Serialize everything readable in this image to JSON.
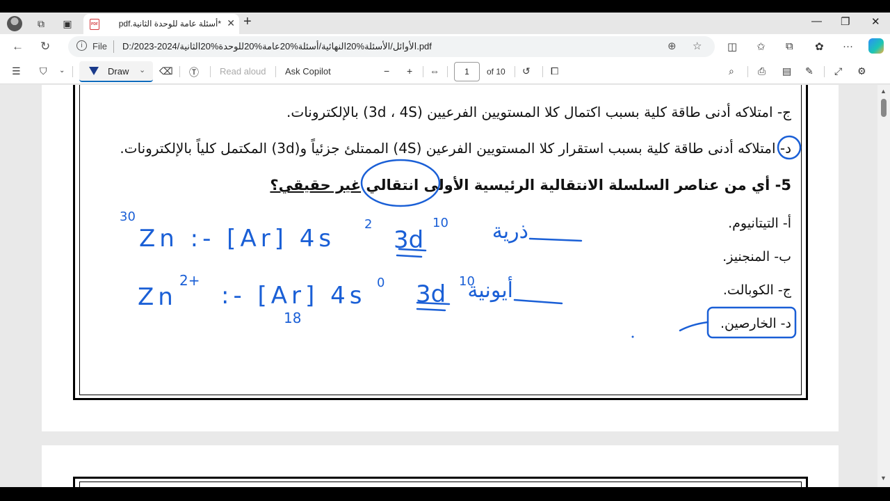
{
  "tab": {
    "title": "*أسئلة عامة للوحدة الثانية.pdf"
  },
  "address": {
    "scheme": "File",
    "path": "D:/2023-2024/الأوائل/الأسئلة%20النهائية/أسئلة%20عامة%20للوحدة%20الثانية.pdf"
  },
  "pdf_toolbar": {
    "draw_label": "Draw",
    "read_aloud": "Read aloud",
    "ask_copilot": "Ask Copilot",
    "page_current": "1",
    "page_total": "of 10"
  },
  "document": {
    "option_j_prev": "ج- امتلاكه أدنى طاقة كلية بسبب اكتمال كلا المستويين الفرعيين (3d ، 4S) بالإلكترونات.",
    "option_d_prev": "د- امتلاكه أدنى طاقة كلية بسبب استقرار كلا المستويين الفرعين (4S) الممتلئ جزئياً و(3d) المكتمل كلياً بالإلكترونات.",
    "question5_main": "5- أي من عناصر السلسلة الانتقالية الرئيسية الأولى انتقالي ",
    "question5_emph": "غير حقيقي؟",
    "options": [
      "أ- التيتانيوم.",
      "ب- المنجنيز.",
      "ج- الكوبالت.",
      "د- الخارصين."
    ]
  },
  "annotations": {
    "line1": "Zn :- [Ar] 4s",
    "line1_sup1": "2",
    "line1_3d": "3d",
    "line1_sup2": "10",
    "line1_z": "30",
    "line1_arabic": "ذرية",
    "line2": "Zn",
    "line2_charge": "2+",
    "line2_config": ":- [Ar] 4s",
    "line2_sup1": "0",
    "line2_3d": "3d",
    "line2_sup2": "10",
    "line2_sub": "18",
    "line2_arabic": "أيونية"
  },
  "colors": {
    "ink": "#1a5fd6",
    "accent": "#0f6cbd"
  }
}
